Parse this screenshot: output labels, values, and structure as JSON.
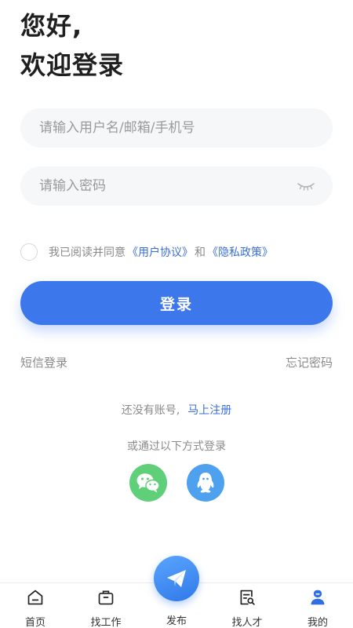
{
  "greeting": {
    "line1": "您好,",
    "line2": "欢迎登录"
  },
  "form": {
    "username_placeholder": "请输入用户名/邮箱/手机号",
    "username_value": "",
    "password_placeholder": "请输入密码",
    "password_value": ""
  },
  "agreement": {
    "prefix": "我已阅读并同意",
    "user_agreement": "《用户协议》",
    "and": "和",
    "privacy_policy": "《隐私政策》",
    "checked": false
  },
  "login_button": "登录",
  "links": {
    "sms_login": "短信登录",
    "forgot_password": "忘记密码"
  },
  "register": {
    "prompt": "还没有账号,",
    "action": "马上注册"
  },
  "other_login": {
    "title": "或通过以下方式登录",
    "methods": [
      {
        "icon": "wechat-icon"
      },
      {
        "icon": "qq-icon"
      }
    ]
  },
  "tabbar": {
    "items": [
      {
        "label": "首页",
        "icon": "home-icon"
      },
      {
        "label": "找工作",
        "icon": "briefcase-icon"
      },
      {
        "label": "发布",
        "icon": "paper-plane-icon"
      },
      {
        "label": "找人才",
        "icon": "search-document-icon"
      },
      {
        "label": "我的",
        "icon": "profile-icon"
      }
    ],
    "active_index": 4
  },
  "colors": {
    "accent": "#3c78ec",
    "link": "#3b6fd8",
    "wechat": "#5fcf7a",
    "qq": "#4ea1ee"
  }
}
